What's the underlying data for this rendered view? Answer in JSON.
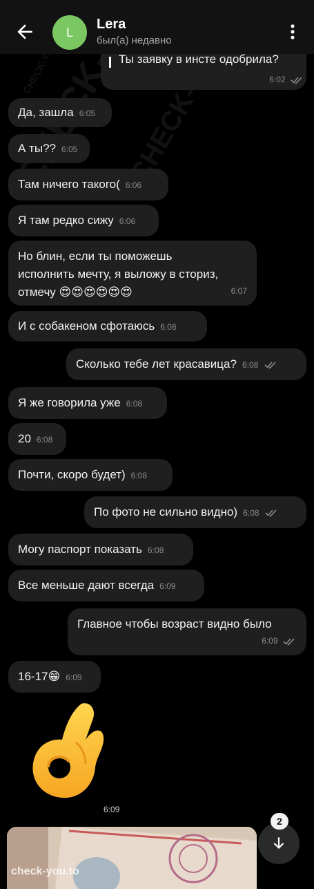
{
  "header": {
    "avatar_letter": "L",
    "title": "Lera",
    "subtitle": "был(а) недавно",
    "avatar_color": "#7bc862"
  },
  "messages": [
    {
      "text": "Ты заявку в инсте одобрила?",
      "time": "6:02",
      "outgoing": true,
      "read": true
    },
    {
      "text": "Да, зашла",
      "time": "6:05",
      "outgoing": false
    },
    {
      "text": "А ты??",
      "time": "6:05",
      "outgoing": false
    },
    {
      "text": "Там ничего такого(",
      "time": "6:06",
      "outgoing": false
    },
    {
      "text": "Я там редко сижу",
      "time": "6:06",
      "outgoing": false
    },
    {
      "lines": [
        "Но блин, если ты поможешь",
        "исполнить мечту, я выложу в сториз,",
        "отмечу 😍😍😍😍😍😍"
      ],
      "time": "6:07",
      "outgoing": false
    },
    {
      "text": "И с собакеном сфотаюсь",
      "time": "6:08",
      "outgoing": false
    },
    {
      "text": "Сколько тебе лет красавица?",
      "time": "6:08",
      "outgoing": true,
      "read": true
    },
    {
      "text": "Я же говорила уже",
      "time": "6:08",
      "outgoing": false
    },
    {
      "text": "20",
      "time": "6:08",
      "outgoing": false
    },
    {
      "text": "Почти, скоро будет)",
      "time": "6:08",
      "outgoing": false
    },
    {
      "text": "По фото не сильно видно)",
      "time": "6:08",
      "outgoing": true,
      "read": true
    },
    {
      "text": "Могу паспорт показать",
      "time": "6:08",
      "outgoing": false
    },
    {
      "text": "Все меньше дают всегда",
      "time": "6:09",
      "outgoing": false
    },
    {
      "text": "Главное чтобы возраст видно было",
      "time": "6:09",
      "outgoing": true,
      "read": true
    },
    {
      "text": "16-17😁",
      "time": "6:09",
      "outgoing": false
    }
  ],
  "sticker": {
    "emoji": "ok-hand",
    "time": "6:09"
  },
  "photo": {
    "label": "check-you.to"
  },
  "scroll_button": {
    "unread_count": "2"
  },
  "watermarks": [
    "CHECK-YOU.ME",
    "CHECK-YOU.ME",
    "CHECK-YOU.ME"
  ],
  "colors": {
    "bubble": "#1f1f1f",
    "background": "#000000",
    "time": "#8a8a8a"
  }
}
